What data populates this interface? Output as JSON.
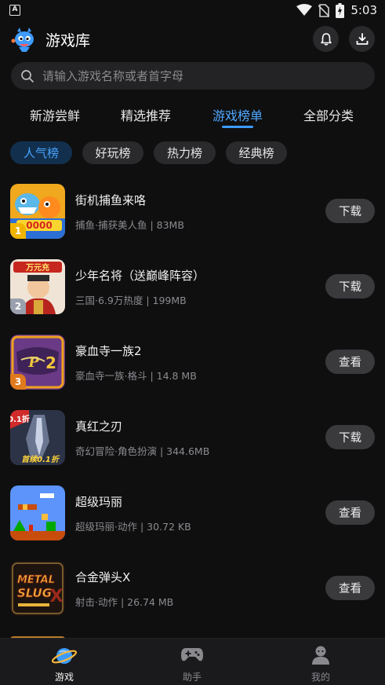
{
  "status_bar": {
    "time": "5:03",
    "app_icon_letter": "A"
  },
  "header": {
    "title": "游戏库"
  },
  "search": {
    "placeholder": "请输入游戏名称或者首字母"
  },
  "tabs": [
    {
      "label": "新游尝鲜"
    },
    {
      "label": "精选推荐"
    },
    {
      "label": "游戏榜单",
      "active": true
    },
    {
      "label": "全部分类"
    }
  ],
  "chips": [
    {
      "label": "人气榜",
      "active": true
    },
    {
      "label": "好玩榜"
    },
    {
      "label": "热力榜"
    },
    {
      "label": "经典榜"
    }
  ],
  "games": [
    {
      "rank": "1",
      "title": "街机捕鱼来咯",
      "subtitle": "捕鱼·捕获美人鱼 | 83MB",
      "action": "下载"
    },
    {
      "rank": "2",
      "title": "少年名将（送巅峰阵容）",
      "subtitle": "三国·6.9万热度 | 199MB",
      "action": "下载",
      "badge": "万元充"
    },
    {
      "rank": "3",
      "title": "豪血寺一族2",
      "subtitle": "豪血寺一族·格斗 | 14.8 MB",
      "action": "查看"
    },
    {
      "title": "真红之刃",
      "subtitle": "奇幻冒险·角色扮演 | 344.6MB",
      "action": "下载",
      "badge": "0.1折",
      "caption": "首续0.1折"
    },
    {
      "title": "超级玛丽",
      "subtitle": "超级玛丽·动作 | 30.72 KB",
      "action": "查看"
    },
    {
      "title": "合金弹头X",
      "subtitle": "射击·动作 | 26.74 MB",
      "action": "查看",
      "art_text": "METAL SLUG X"
    }
  ],
  "bottom_nav": [
    {
      "label": "游戏",
      "active": true,
      "icon": "planet-icon"
    },
    {
      "label": "助手",
      "icon": "gamepad-icon"
    },
    {
      "label": "我的",
      "icon": "user-icon"
    }
  ],
  "colors": {
    "accent": "#3d9bff",
    "background": "#0f0f10",
    "chip_active_bg": "#12304e",
    "button_bg": "#3a3a3d"
  }
}
